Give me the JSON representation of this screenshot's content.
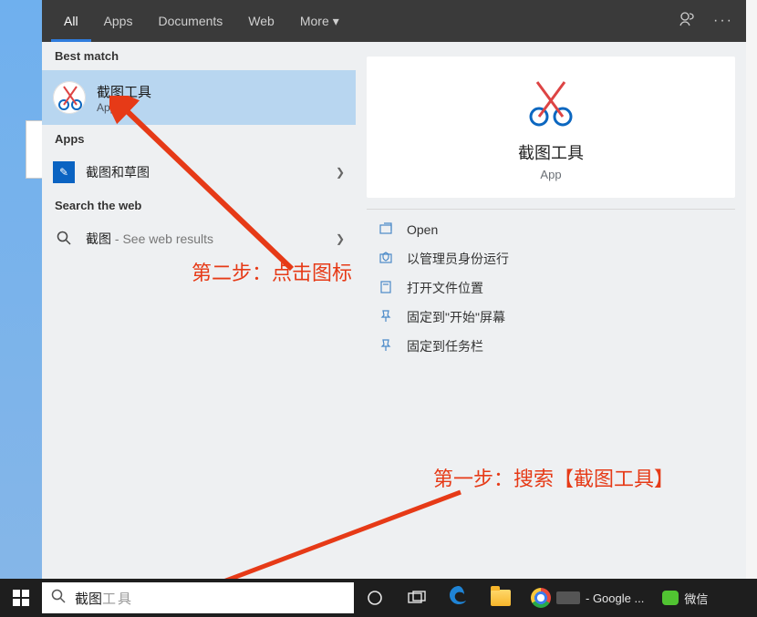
{
  "tabs": {
    "all": "All",
    "apps": "Apps",
    "documents": "Documents",
    "web": "Web",
    "more": "More"
  },
  "left": {
    "best_match_header": "Best match",
    "best_match_title": "截图工具",
    "best_match_sub": "App",
    "apps_header": "Apps",
    "app1_label": "截图和草图",
    "web_header": "Search the web",
    "web_term": "截图",
    "web_suffix": " - See web results"
  },
  "right": {
    "title": "截图工具",
    "sub": "App",
    "open": "Open",
    "runadmin": "以管理员身份运行",
    "openloc": "打开文件位置",
    "pinstart": "固定到\"开始\"屏幕",
    "pintask": "固定到任务栏"
  },
  "annotations": {
    "step2": "第二步：点击图标",
    "step1": "第一步：搜索【截图工具】"
  },
  "taskbar": {
    "search_value": "截图",
    "search_placeholder": "工具",
    "chrome_label": " - Google ...",
    "wechat_label": "微信"
  }
}
